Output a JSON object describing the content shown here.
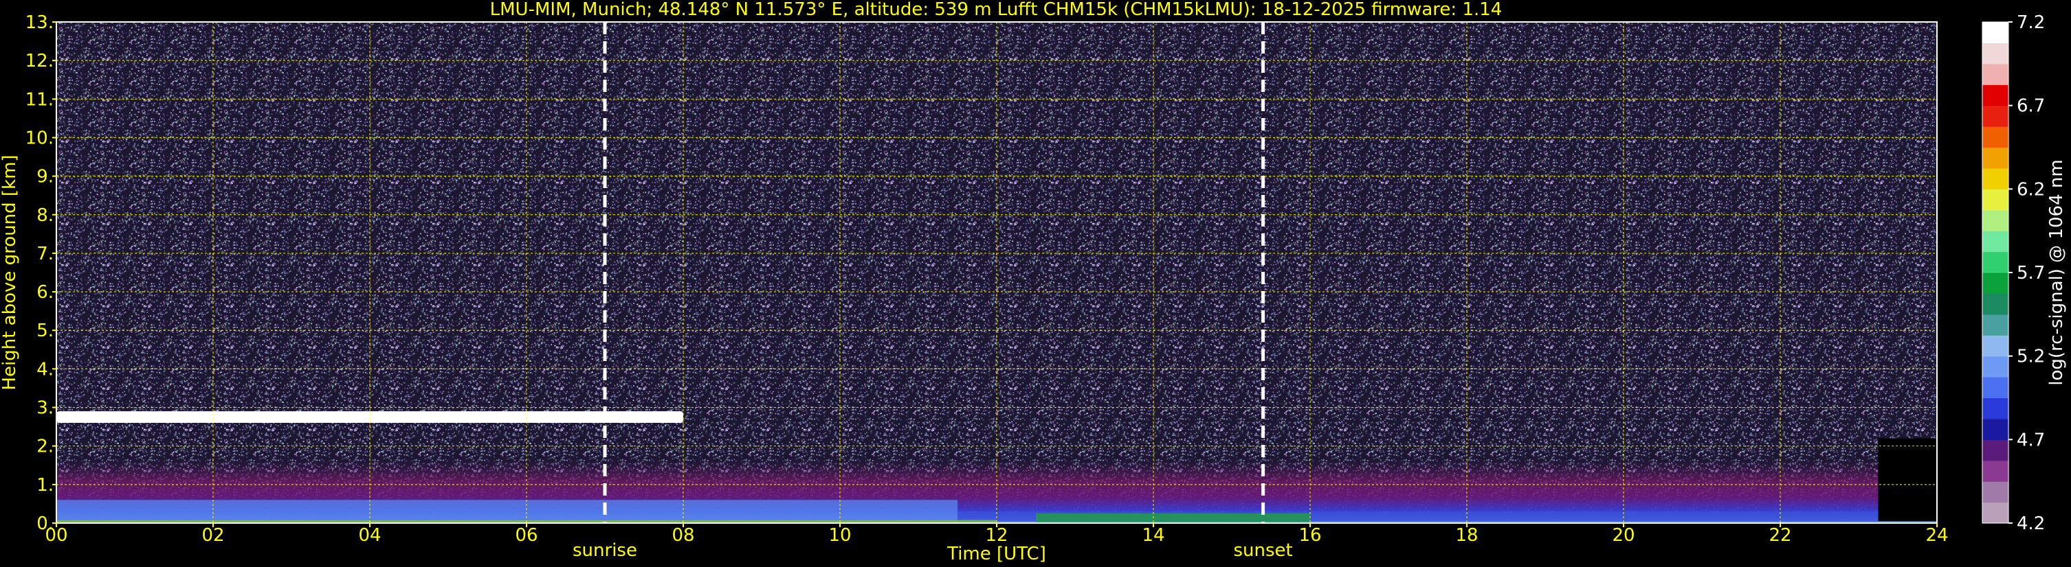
{
  "header": {
    "title": "LMU-MIM, Munich; 48.148° N 11.573° E, altitude: 539 m    Lufft CHM15k (CHM15kLMU): 18-12-2025    firmware: 1.14"
  },
  "chart_data": {
    "type": "heatmap",
    "xlabel": "Time [UTC]",
    "ylabel": "Height above ground [km]",
    "xlim": [
      0,
      24
    ],
    "ylim": [
      0,
      13
    ],
    "x_ticks": [
      "00",
      "02",
      "04",
      "06",
      "08",
      "10",
      "12",
      "14",
      "16",
      "18",
      "20",
      "22",
      "24"
    ],
    "y_ticks": [
      "0.",
      "1.",
      "2.",
      "3.",
      "4.",
      "5.",
      "6.",
      "7.",
      "8.",
      "9.",
      "10.",
      "11.",
      "12.",
      "13."
    ],
    "grid": true,
    "grid_color": "#ffff00",
    "axis_text_color": "#ffff00",
    "markers": [
      {
        "name": "sunrise",
        "x": 7.0,
        "color": "#ffffff"
      },
      {
        "name": "sunset",
        "x": 15.4,
        "color": "#ffffff"
      }
    ],
    "colorbar": {
      "label": "log(rc-signal) @ 1064 nm",
      "range": [
        4.2,
        7.2
      ],
      "ticks": [
        "7.2",
        "6.7",
        "6.2",
        "5.7",
        "5.2",
        "4.7",
        "4.2"
      ],
      "colors": [
        "#b8a0b8",
        "#a07aa8",
        "#8a3a90",
        "#5a1a7a",
        "#1a1aa0",
        "#2a3ad8",
        "#4a70f0",
        "#6f9af5",
        "#90b8f0",
        "#4aa0a0",
        "#1a8a60",
        "#0aa03a",
        "#30d070",
        "#70e8a0",
        "#b0f080",
        "#e8f040",
        "#f0d000",
        "#f0a000",
        "#f06000",
        "#e82010",
        "#e00000",
        "#f0b0b0",
        "#f0d8d8",
        "#ffffff"
      ]
    },
    "features": {
      "cloud_layer": {
        "t_start": 0.0,
        "t_end": 8.0,
        "height_km": [
          2.6,
          2.9
        ]
      },
      "boundary_layer_top_km": 1.7,
      "data_gap": {
        "t_start": 23.25,
        "t_end": 24.0
      }
    }
  }
}
